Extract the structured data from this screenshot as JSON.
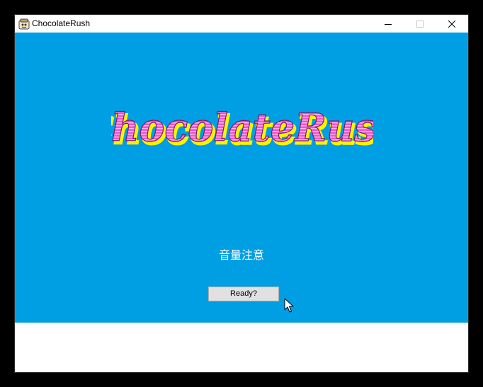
{
  "window": {
    "title": "ChocolateRush",
    "app_icon": "game-app-icon",
    "controls": {
      "minimize_icon": "minimize-icon",
      "maximize_icon": "maximize-icon",
      "close_icon": "close-icon"
    }
  },
  "game": {
    "logo_text": "ChocolateRush",
    "volume_warning": "音量注意",
    "ready_label": "Ready?",
    "background_color": "#009fe4",
    "logo_colors": {
      "main": "#e858c8",
      "stripe": "#ffb0ee",
      "shadow": "#fff200",
      "outline": "#7a1a6a"
    }
  },
  "cursor": {
    "icon": "mouse-pointer-icon"
  }
}
